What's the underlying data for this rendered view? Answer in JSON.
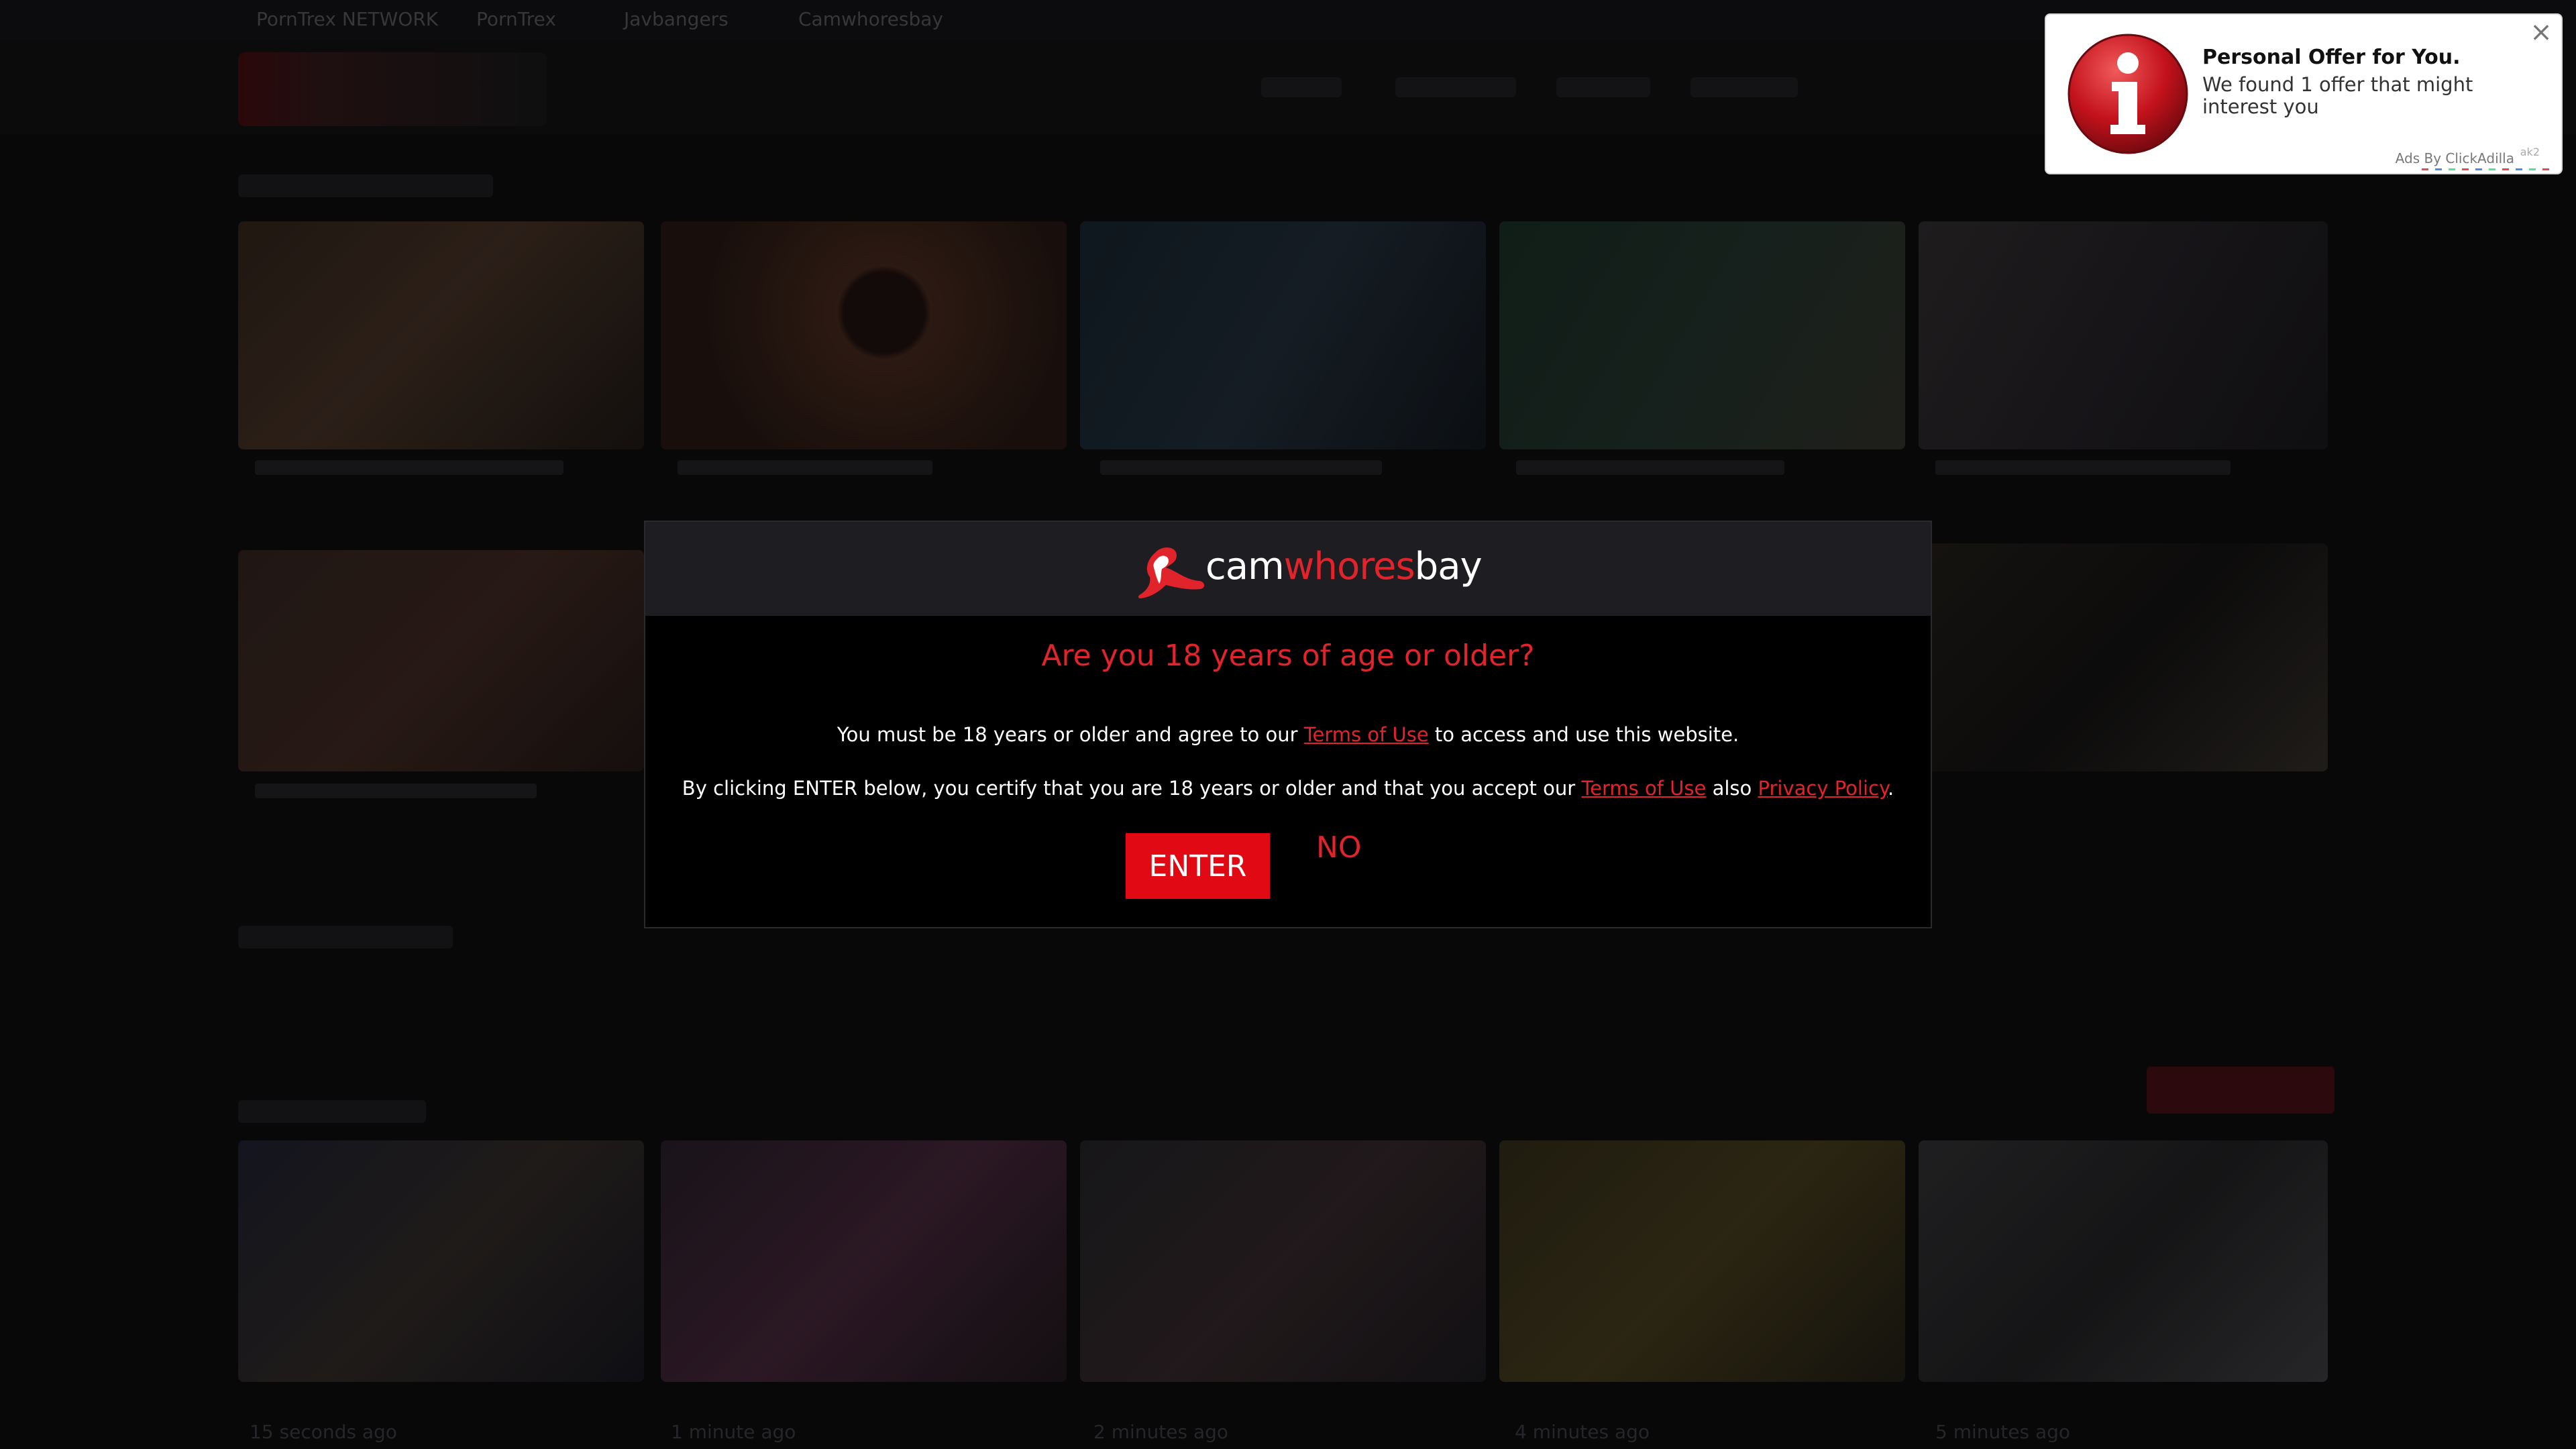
{
  "network": {
    "links": [
      "PornTrex NETWORK",
      "PornTrex",
      "Javbangers",
      "Camwhoresbay"
    ]
  },
  "thumbnails_meta": [
    "15 seconds ago",
    "1 minute ago",
    "2 minutes ago",
    "4 minutes ago",
    "5 minutes ago"
  ],
  "age_gate": {
    "logo": {
      "cam": "cam",
      "whores": "whores",
      "bay": "bay"
    },
    "title": "Are you 18 years of age or older?",
    "line1_pre": "You must be 18 years or older and agree to our",
    "line1_link": "Terms of Use",
    "line1_post": "to access and use this website.",
    "line2_pre": "By clicking ENTER below, you certify that you are 18 years or older and that you accept our",
    "line2_link1": "Terms of Use",
    "line2_mid": "also",
    "line2_link2": "Privacy Policy",
    "line2_post": ".",
    "enter_label": "ENTER",
    "no_label": "NO",
    "colors": {
      "accent": "#e1232b",
      "button": "#e00914",
      "header": "#1e1e22"
    }
  },
  "push_ad": {
    "title": "Personal Offer for You.",
    "text": "We found 1 offer that might interest you",
    "ads_by": "Ads By ClickAdilla",
    "tag": "ak2",
    "icon": "info-icon",
    "close_icon": "close-icon"
  }
}
